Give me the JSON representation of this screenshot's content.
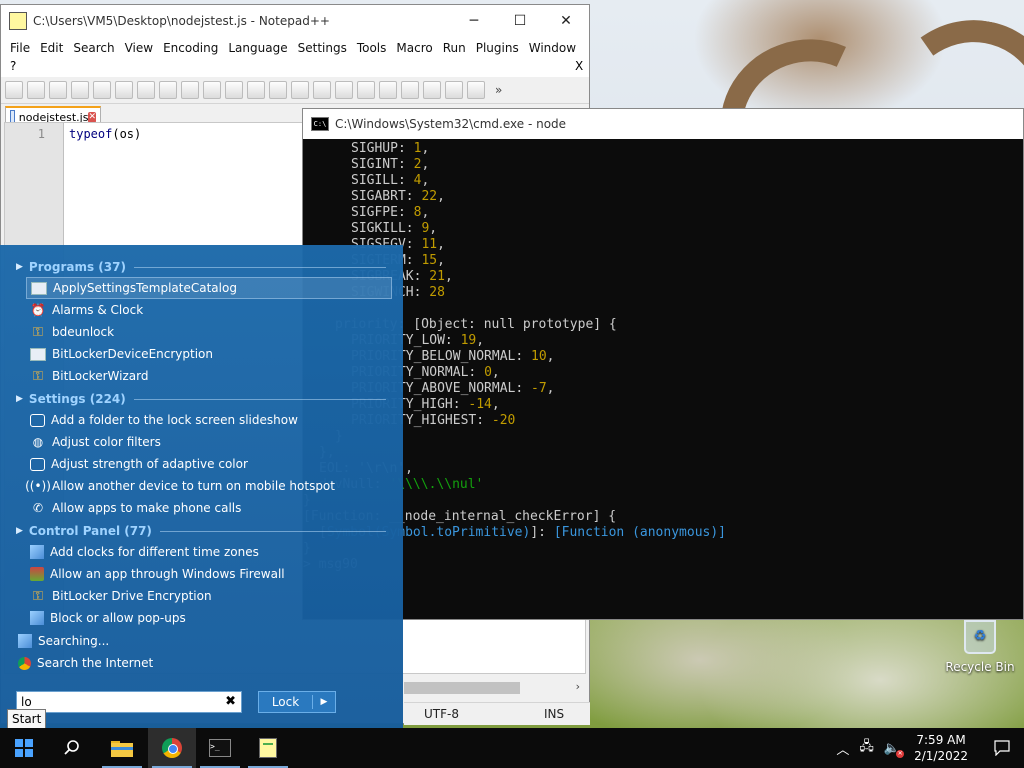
{
  "desktop": {
    "recycle_bin_label": "Recycle Bin"
  },
  "notepad": {
    "title": "C:\\Users\\VM5\\Desktop\\nodejstest.js - Notepad++",
    "menu": [
      "File",
      "Edit",
      "Search",
      "View",
      "Encoding",
      "Language",
      "Settings",
      "Tools",
      "Macro",
      "Run",
      "Plugins",
      "Window"
    ],
    "menu_extra": "?",
    "menu_close": "X",
    "tab_label": "nodejstest.js",
    "line_number": "1",
    "code_keyword": "typeof",
    "code_rest": "(os)",
    "status_encoding": "UTF-8",
    "status_mode": "INS"
  },
  "cmd": {
    "title": "C:\\Windows\\System32\\cmd.exe - node"
  },
  "start_menu": {
    "programs": {
      "header": "Programs (37)",
      "items": [
        "ApplySettingsTemplateCatalog",
        "Alarms & Clock",
        "bdeunlock",
        "BitLockerDeviceEncryption",
        "BitLockerWizard"
      ]
    },
    "settings": {
      "header": "Settings (224)",
      "items": [
        "Add a folder to the lock screen slideshow",
        "Adjust color filters",
        "Adjust strength of adaptive color",
        "Allow another device to turn on mobile hotspot",
        "Allow apps to make phone calls"
      ]
    },
    "control_panel": {
      "header": "Control Panel (77)",
      "items": [
        "Add clocks for different time zones",
        "Allow an app through Windows Firewall",
        "BitLocker Drive Encryption",
        "Block or allow pop-ups"
      ]
    },
    "searching": "Searching...",
    "search_internet": "Search the Internet",
    "search_value": "lo",
    "lock_label": "Lock",
    "start_tooltip": "Start"
  },
  "taskbar": {
    "time": "7:59 AM",
    "date": "2/1/2022"
  },
  "colors": {
    "start_menu_bg": "#1c69aa",
    "section_header": "#9fd3ff",
    "console_number": "#c19c00",
    "console_string": "#13a10e",
    "console_function": "#3a96dd",
    "npp_keyword": "#00007f"
  }
}
